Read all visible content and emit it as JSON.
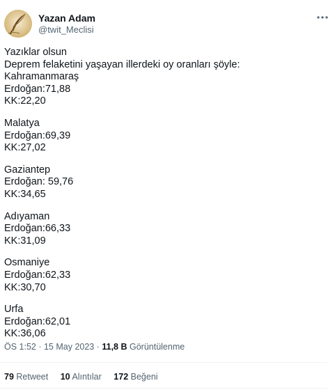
{
  "author": {
    "name": "Yazan Adam",
    "handle": "@twit_Meclisi",
    "avatar_icon": "quill-pen-avatar"
  },
  "more_icon": "more-horizontal-icon",
  "tweet": {
    "intro": [
      "Yazıklar olsun",
      "Deprem felaketini yaşayan illerdeki oy oranları şöyle:"
    ],
    "provinces": [
      {
        "name": "Kahramanmaraş",
        "erdogan": "Erdoğan:71,88",
        "kk": "KK:22,20"
      },
      {
        "name": "Malatya",
        "erdogan": "Erdoğan:69,39",
        "kk": "KK:27,02"
      },
      {
        "name": "Gaziantep",
        "erdogan": "Erdoğan: 59,76",
        "kk": "KK:34,65"
      },
      {
        "name": "Adıyaman",
        "erdogan": "Erdoğan:66,33",
        "kk": "KK:31,09"
      },
      {
        "name": "Osmaniye",
        "erdogan": "Erdoğan:62,33",
        "kk": "KK:30,70"
      },
      {
        "name": "Urfa",
        "erdogan": "Erdoğan:62,01",
        "kk": "KK:36,06"
      }
    ]
  },
  "meta": {
    "time": "ÖS 1:52",
    "separator": " · ",
    "date": "15 May 2023",
    "views_count": "11,8 B",
    "views_label": " Görüntülenme"
  },
  "stats": {
    "retweets_count": "79",
    "retweets_label": " Retweet",
    "quotes_count": "10",
    "quotes_label": " Alıntılar",
    "likes_count": "172",
    "likes_label": " Beğeni"
  }
}
